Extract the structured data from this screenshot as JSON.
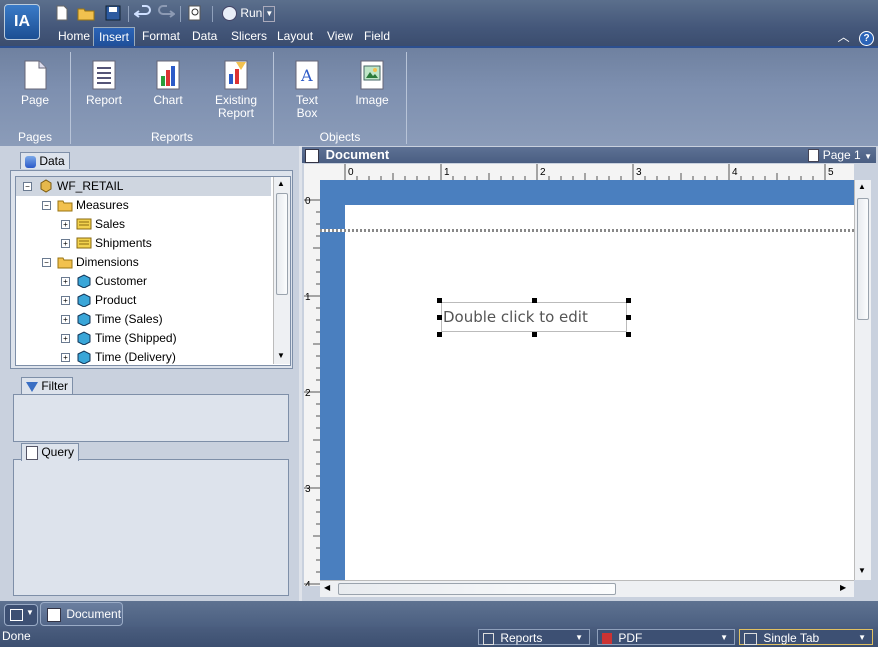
{
  "app": {
    "logo_text": "IA"
  },
  "quick_access": {
    "run_label": "Run",
    "icons": [
      "new-icon",
      "open-folder-icon",
      "save-icon",
      "undo-icon",
      "redo-icon",
      "preview-icon",
      "run-icon"
    ]
  },
  "menu_tabs": [
    {
      "label": "Home"
    },
    {
      "label": "Insert",
      "active": true
    },
    {
      "label": "Format"
    },
    {
      "label": "Data"
    },
    {
      "label": "Slicers"
    },
    {
      "label": "Layout"
    },
    {
      "label": "View"
    },
    {
      "label": "Field"
    }
  ],
  "ribbon": {
    "groups": [
      {
        "label": "Pages",
        "buttons": [
          {
            "label": "Page"
          }
        ]
      },
      {
        "label": "Reports",
        "buttons": [
          {
            "label": "Report"
          },
          {
            "label": "Chart"
          },
          {
            "label": "Existing Report"
          }
        ]
      },
      {
        "label": "Objects",
        "buttons": [
          {
            "label": "Text Box"
          },
          {
            "label": "Image"
          }
        ]
      }
    ]
  },
  "panels": {
    "data_title": "Data",
    "filter_title": "Filter",
    "query_title": "Query"
  },
  "tree": {
    "root": "WF_RETAIL",
    "measures": "Measures",
    "measure_items": [
      "Sales",
      "Shipments"
    ],
    "dimensions": "Dimensions",
    "dimension_items": [
      "Customer",
      "Product",
      "Time (Sales)",
      "Time (Shipped)",
      "Time (Delivery)"
    ]
  },
  "document": {
    "title": "Document",
    "page_selector": "Page 1",
    "textbox_text": "Double click to edit",
    "ruler_h_labels": [
      "0",
      "1",
      "2",
      "3",
      "4",
      "5"
    ],
    "ruler_v_labels": [
      "0",
      "1",
      "2",
      "3",
      "4"
    ]
  },
  "bottom_tab": {
    "label": "Document"
  },
  "status": {
    "text": "Done",
    "reports": "Reports",
    "format": "PDF",
    "layout": "Single Tab"
  },
  "colors": {
    "accent": "#2b64b8",
    "canvas": "#4a7fbf",
    "chrome": "#4b5f80"
  }
}
